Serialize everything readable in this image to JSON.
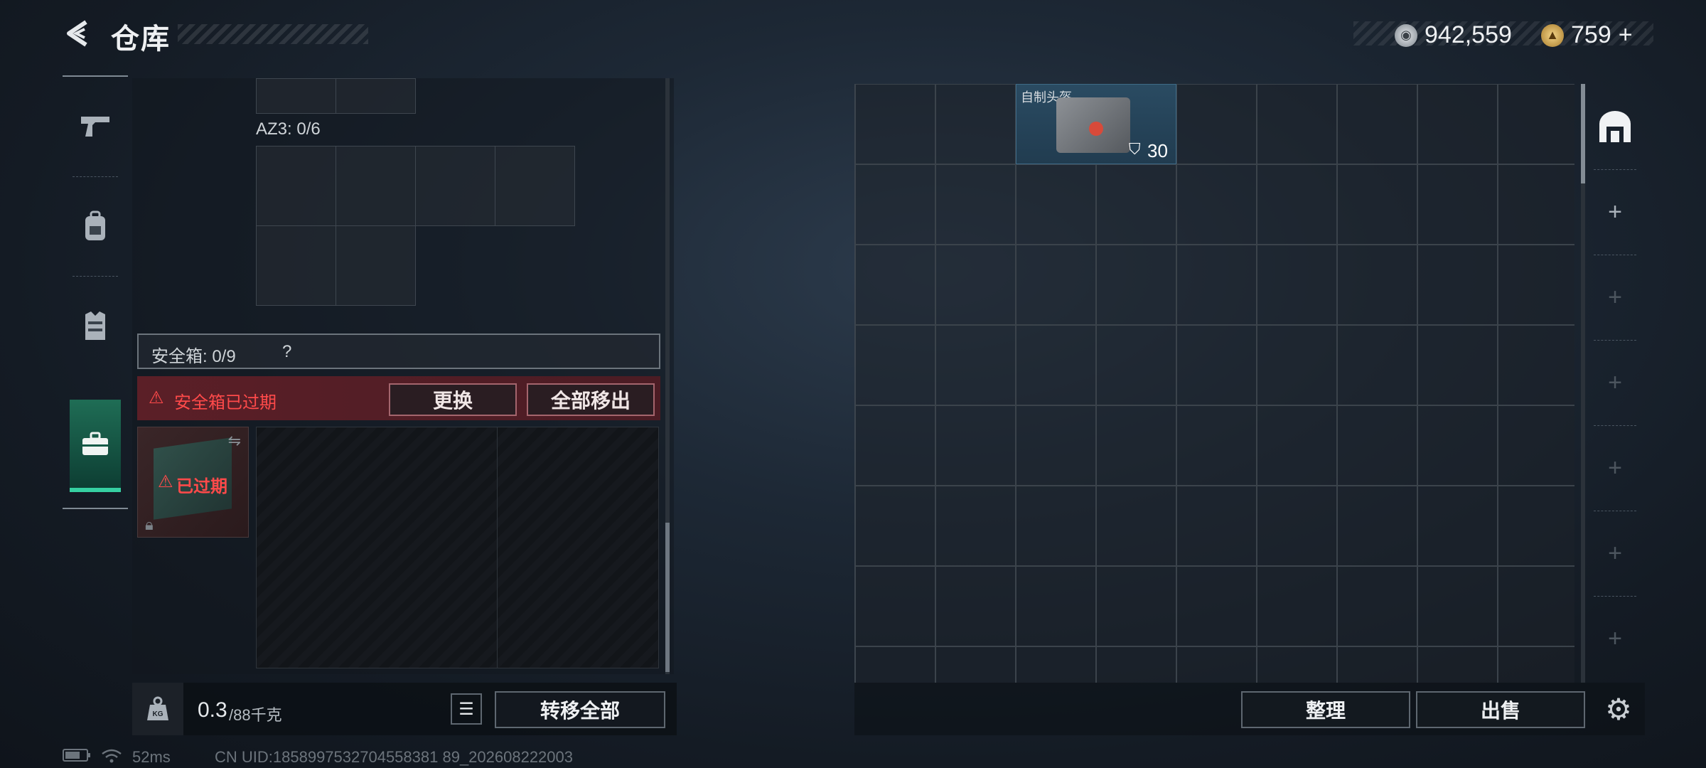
{
  "header": {
    "title": "仓库",
    "back_icon": "back-arrow-icon"
  },
  "currency": {
    "silver_amount": "942,559",
    "gold_amount": "759",
    "gold_plus": "+"
  },
  "sidebar": {
    "items": [
      {
        "name": "weapon",
        "icon": "pistol-icon",
        "active": false
      },
      {
        "name": "backpack",
        "icon": "backpack-icon",
        "active": false
      },
      {
        "name": "vest",
        "icon": "vest-icon",
        "active": false
      },
      {
        "name": "case",
        "icon": "briefcase-icon",
        "active": true
      }
    ]
  },
  "left_panel": {
    "az3_label": "AZ3: 0/6",
    "safe_box_label": "安全箱: 0/9",
    "help": "?",
    "expired_warning": "安全箱已过期",
    "replace_button": "更换",
    "move_all_out_button": "全部移出",
    "expired_badge": "已过期"
  },
  "bottom_left": {
    "weight_current": "0.3",
    "weight_max": "/88千克",
    "transfer_all_button": "转移全部"
  },
  "right_panel": {
    "item": {
      "name": "自制头盔",
      "durability": "30"
    },
    "sort_button": "整理",
    "sell_button": "出售"
  },
  "status_bar": {
    "ping": "52ms",
    "uid": "CN UID:1858997532704558381 89_202608222003"
  },
  "colors": {
    "accent": "#36d0a2",
    "warning": "#ff4a4a"
  }
}
